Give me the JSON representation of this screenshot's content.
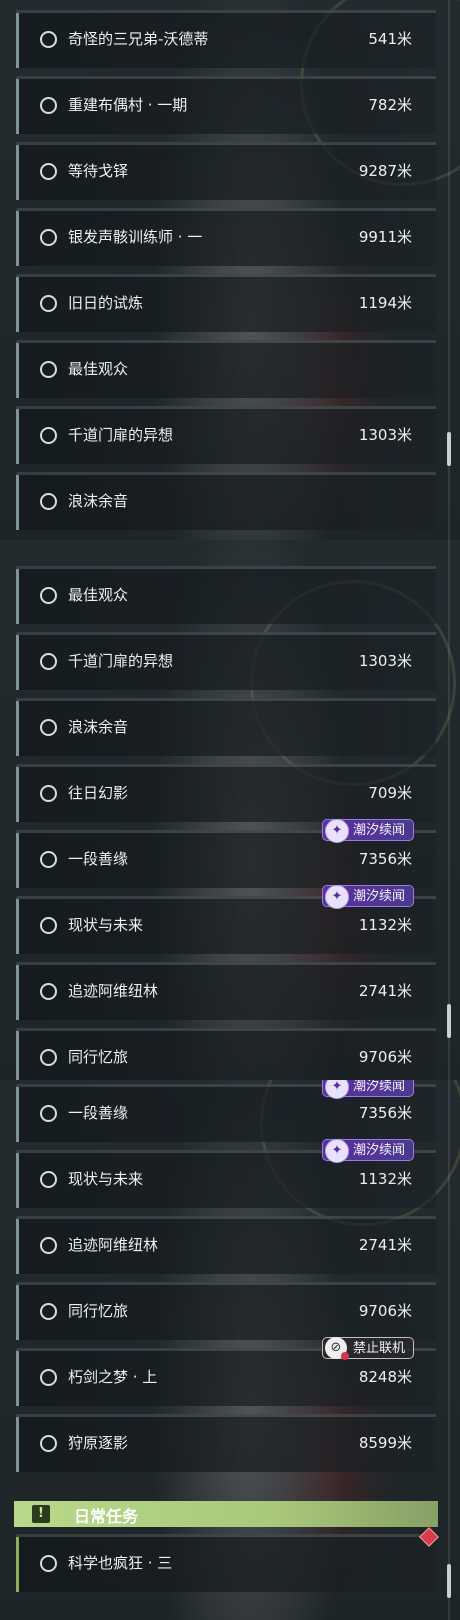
{
  "panel1": {
    "rows": [
      {
        "label": "奇怪的三兄弟-沃德蒂",
        "distance": "541米"
      },
      {
        "label": "重建布偶村 · 一期",
        "distance": "782米"
      },
      {
        "label": "等待戈铎",
        "distance": "9287米"
      },
      {
        "label": "银发声骸训练师 · 一",
        "distance": "9911米"
      },
      {
        "label": "旧日的试炼",
        "distance": "1194米"
      },
      {
        "label": "最佳观众",
        "distance": ""
      },
      {
        "label": "千道门扉的异想",
        "distance": "1303米"
      },
      {
        "label": "浪沫余音",
        "distance": ""
      }
    ]
  },
  "panel2": {
    "rows": [
      {
        "label": "最佳观众",
        "distance": ""
      },
      {
        "label": "千道门扉的异想",
        "distance": "1303米"
      },
      {
        "label": "浪沫余音",
        "distance": ""
      },
      {
        "label": "往日幻影",
        "distance": "709米"
      },
      {
        "label": "一段善缘",
        "distance": "7356米",
        "badge": "潮汐续闻"
      },
      {
        "label": "现状与未来",
        "distance": "1132米",
        "badge": "潮汐续闻"
      },
      {
        "label": "追迹阿维纽林",
        "distance": "2741米"
      },
      {
        "label": "同行忆旅",
        "distance": "9706米"
      }
    ]
  },
  "panel3": {
    "rows": [
      {
        "label": "一段善缘",
        "distance": "7356米",
        "badge": "潮汐续闻"
      },
      {
        "label": "现状与未来",
        "distance": "1132米",
        "badge": "潮汐续闻"
      },
      {
        "label": "追迹阿维纽林",
        "distance": "2741米"
      },
      {
        "label": "同行忆旅",
        "distance": "9706米"
      },
      {
        "label": "朽剑之梦 · 上",
        "distance": "8248米",
        "badge": "禁止联机",
        "badge_type": "nocoop"
      },
      {
        "label": "狩原逐影",
        "distance": "8599米"
      }
    ],
    "section_title": "日常任务",
    "section_icon": "!",
    "daily_rows": [
      {
        "label": "科学也疯狂 · 三",
        "distance": ""
      }
    ]
  },
  "badge_icons": {
    "tide": "tide-spiral-icon",
    "nocoop": "no-coop-icon"
  },
  "colors": {
    "tide_badge": "#5a2f9e",
    "daily_header": "#b8d88a",
    "row_bar": "#7f9499",
    "daily_bar": "#8fb05a",
    "alert": "#d83c4c"
  }
}
